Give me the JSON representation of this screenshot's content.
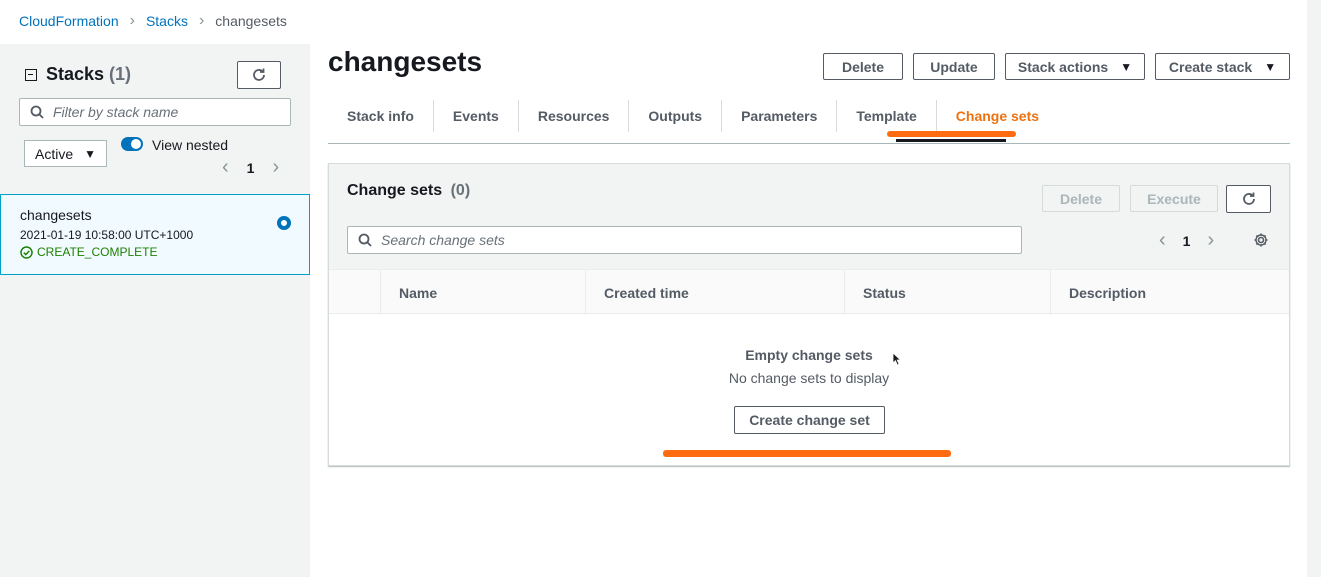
{
  "breadcrumb": {
    "items": [
      "CloudFormation",
      "Stacks"
    ],
    "current": "changesets"
  },
  "left_panel": {
    "title": "Stacks",
    "count": "(1)",
    "search_placeholder": "Filter by stack name",
    "filter_value": "Active",
    "view_nested_label": "View nested",
    "view_nested_enabled": true,
    "page": "1",
    "stacks": [
      {
        "name": "changesets",
        "time": "2021-01-19 10:58:00 UTC+1000",
        "status": "CREATE_COMPLETE",
        "selected": true
      }
    ]
  },
  "main": {
    "title": "changesets",
    "actions": {
      "delete": "Delete",
      "update": "Update",
      "stack_actions": "Stack actions",
      "create_stack": "Create stack"
    },
    "tabs": [
      {
        "label": "Stack info"
      },
      {
        "label": "Events"
      },
      {
        "label": "Resources"
      },
      {
        "label": "Outputs"
      },
      {
        "label": "Parameters"
      },
      {
        "label": "Template"
      },
      {
        "label": "Change sets",
        "active": true
      }
    ]
  },
  "change_sets": {
    "title": "Change sets",
    "count": "(0)",
    "delete_label": "Delete",
    "execute_label": "Execute",
    "search_placeholder": "Search change sets",
    "page": "1",
    "columns": [
      "Name",
      "Created time",
      "Status",
      "Description"
    ],
    "empty_title": "Empty change sets",
    "empty_subtitle": "No change sets to display",
    "create_label": "Create change set"
  },
  "colors": {
    "link": "#0073bb",
    "active_tab": "#ec7211",
    "annotation": "#ff6b10",
    "success": "#1d8102"
  }
}
